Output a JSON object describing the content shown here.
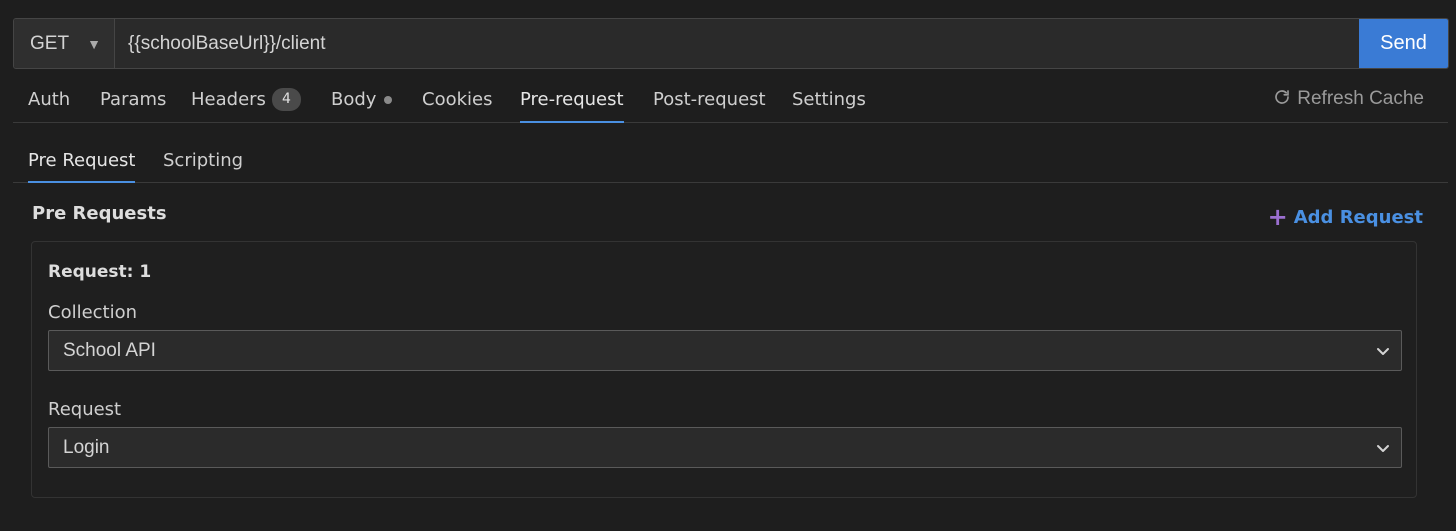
{
  "url_bar": {
    "method": "GET",
    "url": "{{schoolBaseUrl}}/client",
    "send_label": "Send"
  },
  "tabs": [
    {
      "label": "Auth"
    },
    {
      "label": "Params"
    },
    {
      "label": "Headers",
      "badge": "4"
    },
    {
      "label": "Body"
    },
    {
      "label": "Cookies"
    },
    {
      "label": "Pre-request",
      "active": true
    },
    {
      "label": "Post-request"
    },
    {
      "label": "Settings"
    }
  ],
  "refresh_cache_label": "Refresh Cache",
  "subtabs": [
    {
      "label": "Pre Request",
      "active": true
    },
    {
      "label": "Scripting"
    }
  ],
  "section": {
    "title": "Pre Requests",
    "add_label": "Add Request"
  },
  "card": {
    "title": "Request: 1",
    "collection_label": "Collection",
    "collection_value": "School API",
    "request_label": "Request",
    "request_value": "Login"
  },
  "colors": {
    "accent": "#4a90e2",
    "send_button": "#3a7bd5",
    "plus_icon": "#9b6fd0",
    "background": "#1e1e1e"
  },
  "icons": {
    "method_dropdown": "caret-down-icon",
    "refresh": "refresh-icon",
    "add": "plus-icon",
    "select": "chevron-down-icon"
  }
}
